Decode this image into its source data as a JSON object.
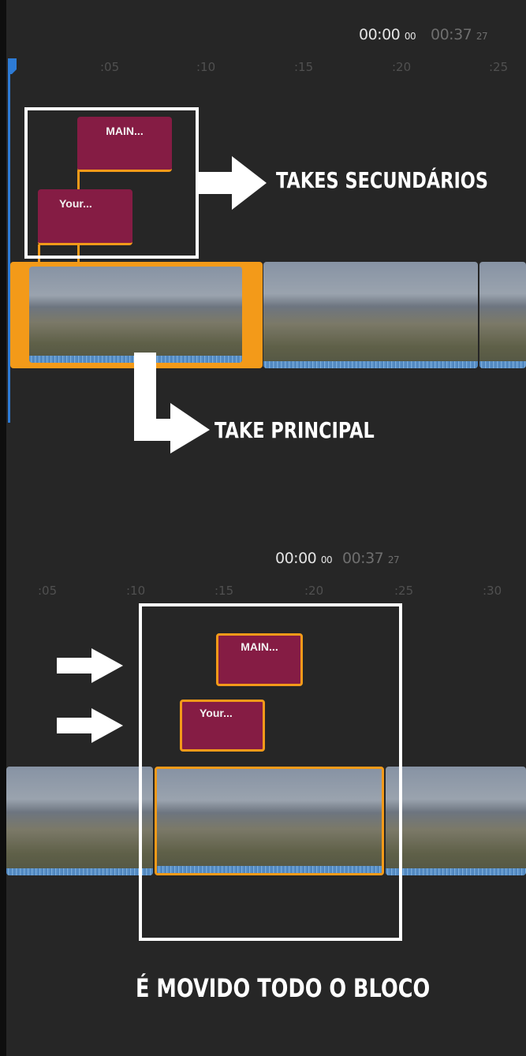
{
  "top": {
    "timecode": {
      "current": "00:00",
      "current_frames": "00",
      "duration": "00:37",
      "duration_frames": "27"
    },
    "ticks": [
      ":05",
      ":10",
      ":15",
      ":20",
      ":25"
    ],
    "clip_main": "MAIN...",
    "clip_your": "Your...",
    "label_secondary": "TAKES SECUNDÁRIOS",
    "label_primary": "TAKE PRINCIPAL"
  },
  "bottom": {
    "timecode": {
      "current": "00:00",
      "current_frames": "00",
      "duration": "00:37",
      "duration_frames": "27"
    },
    "ticks": [
      ":05",
      ":10",
      ":15",
      ":20",
      ":25",
      ":30"
    ],
    "clip_main": "MAIN...",
    "clip_your": "Your...",
    "label_moved": "É MOVIDO TODO O BLOCO"
  },
  "colors": {
    "background": "#262626",
    "selection": "#f39a19",
    "title_clip": "#851c44",
    "playhead": "#2d7bd6",
    "annotation": "#ffffff"
  }
}
